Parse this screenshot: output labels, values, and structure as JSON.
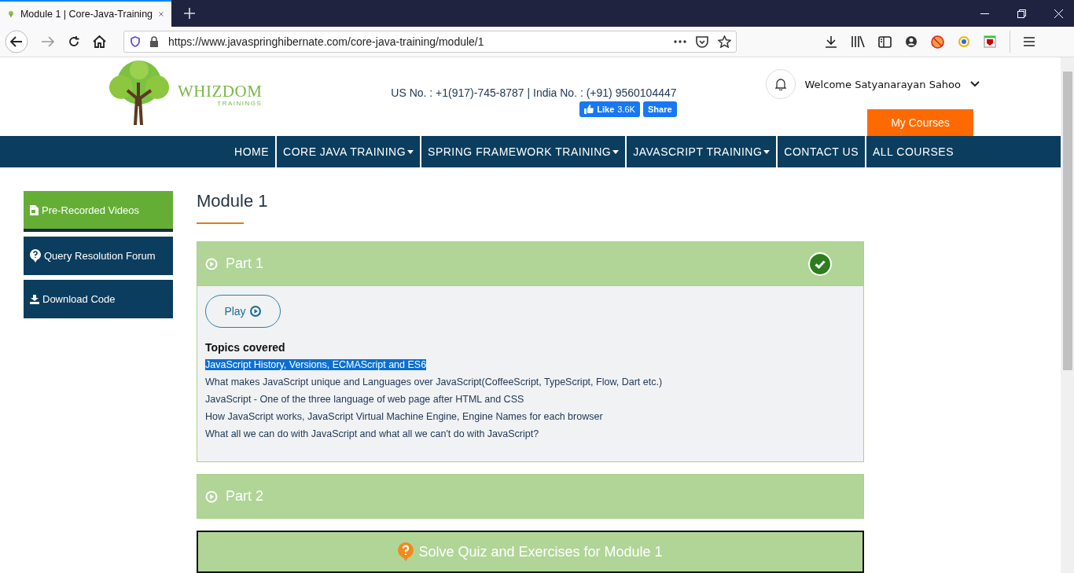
{
  "browser": {
    "tab": {
      "title": "Module 1 | Core-Java-Training",
      "selected": true
    },
    "url": "https://www.javaspringhibernate.com/core-java-training/module/1"
  },
  "header": {
    "logo": {
      "name": "WHIZDOM",
      "tagline": "TRAININGS"
    },
    "phones": "US No. : +1(917)-745-8787 | India No. : (+91) 9560104447",
    "facebook": {
      "like": "Like",
      "count": "3.6K",
      "share": "Share"
    },
    "welcome": "Welcome Satyanarayan Sahoo",
    "my_courses": "My Courses"
  },
  "nav": [
    {
      "label": "HOME",
      "dropdown": false
    },
    {
      "label": "CORE JAVA TRAINING",
      "dropdown": true
    },
    {
      "label": "SPRING FRAMEWORK TRAINING",
      "dropdown": true
    },
    {
      "label": "JAVASCRIPT TRAINING",
      "dropdown": true
    },
    {
      "label": "CONTACT US",
      "dropdown": false
    },
    {
      "label": "ALL COURSES",
      "dropdown": false
    }
  ],
  "sidebar": {
    "items": [
      {
        "label": "Pre-Recorded Videos",
        "kind": "video",
        "selected": true
      },
      {
        "label": "Query Resolution Forum",
        "kind": "forum",
        "selected": false
      },
      {
        "label": "Download Code",
        "kind": "download",
        "selected": false
      }
    ]
  },
  "module": {
    "title": "Module 1",
    "parts": [
      {
        "title": "Part 1",
        "expanded": true,
        "completed": true,
        "play": "Play",
        "topics_heading": "Topics covered",
        "topics": [
          {
            "text": "JavaScript History, Versions, ECMAScript and ES6",
            "highlighted": true
          },
          {
            "text": "What makes JavaScript unique and Languages over JavaScript(CoffeeScript, TypeScript, Flow, Dart etc.)",
            "highlighted": false
          },
          {
            "text": "JavaScript - One of the three language of web page after HTML and CSS",
            "highlighted": false
          },
          {
            "text": "How JavaScript works, JavaScript Virtual Machine Engine, Engine Names for each browser",
            "highlighted": false
          },
          {
            "text": "What all we can do with JavaScript and what all we can't do with JavaScript?",
            "highlighted": false
          }
        ]
      },
      {
        "title": "Part 2",
        "expanded": false,
        "completed": false
      }
    ],
    "quiz": "Solve Quiz and Exercises for Module 1"
  }
}
